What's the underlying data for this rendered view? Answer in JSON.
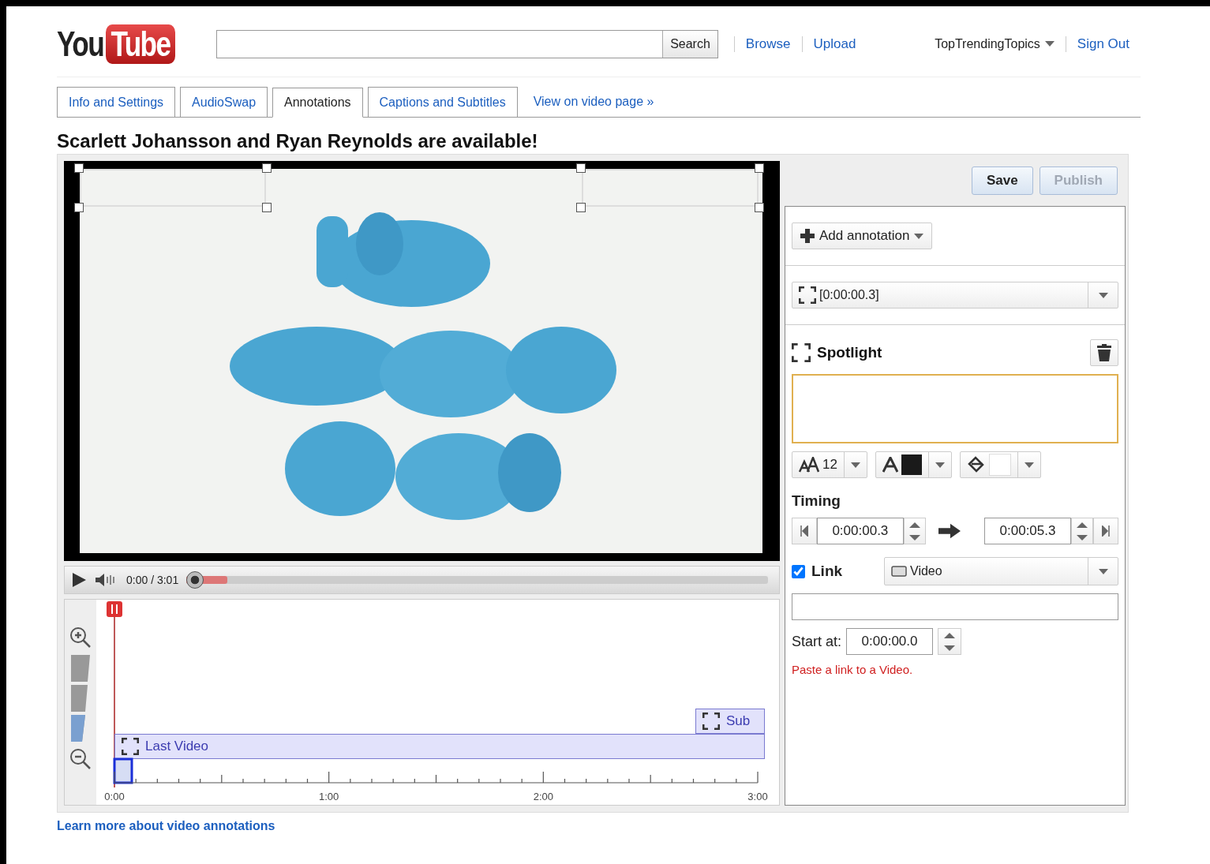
{
  "logo": {
    "you": "You",
    "tube": "Tube"
  },
  "search": {
    "button": "Search"
  },
  "nav": [
    {
      "label": "Browse"
    },
    {
      "label": "Upload"
    }
  ],
  "user": {
    "name": "TopTrendingTopics",
    "sign_out": "Sign Out"
  },
  "tabs": [
    {
      "label": "Info and Settings",
      "selected": false
    },
    {
      "label": "AudioSwap",
      "selected": false
    },
    {
      "label": "Annotations",
      "selected": true
    },
    {
      "label": "Captions and Subtitles",
      "selected": false
    }
  ],
  "view_link": "View on video page »",
  "title": "Scarlett Johansson and Ryan Reynolds are available!",
  "player": {
    "time": "0:00 / 3:01",
    "level": 0.07
  },
  "timeline": {
    "ticks": [
      "0:00",
      "1:00",
      "2:00",
      "3:00"
    ],
    "annotations": [
      {
        "label": "Sub"
      },
      {
        "label": "Last Video"
      }
    ]
  },
  "actions": [
    {
      "label": "Save",
      "disabled": false
    },
    {
      "label": "Publish",
      "disabled": true
    }
  ],
  "add_annotation": "Add annotation",
  "annotation_select": "[0:00:00.3]",
  "editor": {
    "type": "Spotlight",
    "font_size": "12"
  },
  "timing": {
    "label": "Timing",
    "start": "0:00:00.3",
    "end": "0:00:05.3"
  },
  "link": {
    "label": "Link",
    "checked": true,
    "type": "Video",
    "start_label": "Start at:",
    "start": "0:00:00.0",
    "hint": "Paste a link to a Video."
  },
  "footer_link": "Learn more about video annotations"
}
